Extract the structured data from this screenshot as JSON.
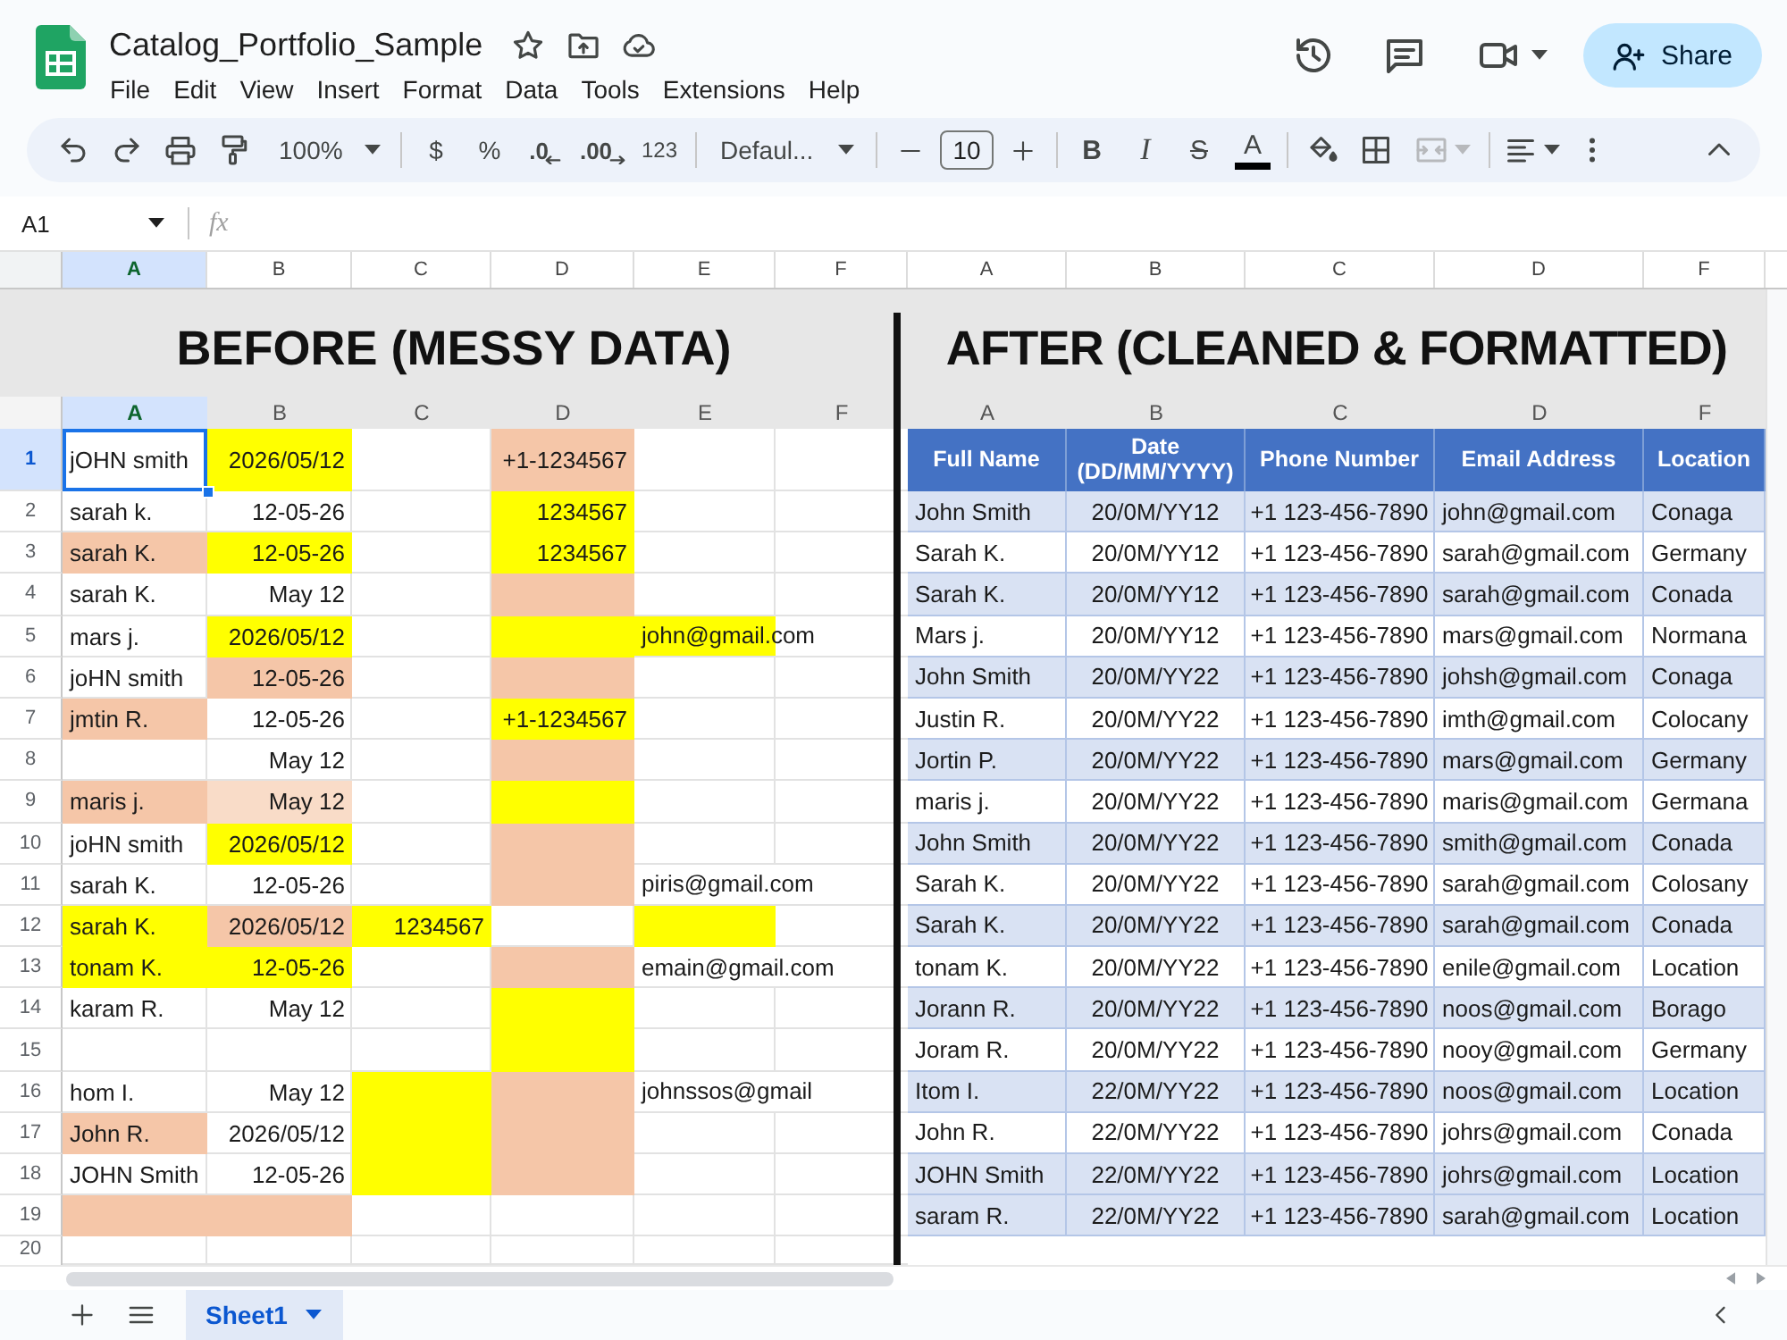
{
  "document": {
    "title": "Catalog_Portfolio_Sample"
  },
  "menu": [
    "File",
    "Edit",
    "View",
    "Insert",
    "Format",
    "Data",
    "Tools",
    "Extensions",
    "Help"
  ],
  "share_button": {
    "label": "Share"
  },
  "toolbar": {
    "zoom": "100%",
    "currency": "$",
    "percent": "%",
    "decrease_decimal": ".0",
    "increase_decimal": ".00",
    "number_format": "123",
    "font": "Defaul...",
    "font_size": "10",
    "bold": "B",
    "italic": "I",
    "strikethrough": "S",
    "text_color": "A",
    "merge_cells": {
      "disabled": true
    }
  },
  "formula_bar": {
    "name_box": "A1",
    "fx": "fx"
  },
  "column_headers": [
    {
      "label": "A",
      "selected": true
    },
    {
      "label": "B",
      "selected": false
    },
    {
      "label": "C",
      "selected": false
    },
    {
      "label": "D",
      "selected": false
    },
    {
      "label": "E",
      "selected": false
    },
    {
      "label": "F",
      "selected": false
    },
    {
      "label": "A",
      "selected": false
    },
    {
      "label": "B",
      "selected": false
    },
    {
      "label": "C",
      "selected": false
    },
    {
      "label": "D",
      "selected": false
    },
    {
      "label": "F",
      "selected": false
    }
  ],
  "before_sheet": {
    "title": "BEFORE (MESSY DATA)",
    "column_headers": [
      {
        "label": "A",
        "selected": true
      },
      {
        "label": "B",
        "selected": false
      },
      {
        "label": "C",
        "selected": false
      },
      {
        "label": "D",
        "selected": false
      },
      {
        "label": "E",
        "selected": false
      },
      {
        "label": "F",
        "selected": false
      }
    ],
    "rows": [
      {
        "number": "1",
        "selected": true,
        "cells": [
          {
            "text": "jOHN smith"
          },
          {
            "text": "2026/05/12",
            "color": "#ffff00"
          },
          {},
          {
            "text": "+1-1234567",
            "color": "#f5c6a8"
          }
        ]
      },
      {
        "number": "2",
        "selected": false,
        "cells": [
          {
            "text": "sarah k."
          },
          {
            "text": "12-05-26"
          },
          {},
          {
            "text": "1234567",
            "color": "#ffff00"
          }
        ]
      },
      {
        "number": "3",
        "selected": false,
        "cells": [
          {
            "text": "sarah K.",
            "color": "#f5c6a8"
          },
          {
            "text": "12-05-26",
            "color": "#ffff00"
          },
          {},
          {
            "text": "1234567",
            "color": "#ffff00"
          }
        ]
      },
      {
        "number": "4",
        "selected": false,
        "cells": [
          {
            "text": "sarah K."
          },
          {
            "text": "May 12"
          },
          {},
          {
            "color": "#f5c6a8"
          }
        ]
      },
      {
        "number": "5",
        "selected": false,
        "cells": [
          {
            "text": "mars j."
          },
          {
            "text": "2026/05/12",
            "color": "#ffff00"
          },
          {},
          {
            "color": "#ffff00"
          },
          {
            "text": "john@gmail.com",
            "color": "#ffff00"
          }
        ]
      },
      {
        "number": "6",
        "selected": false,
        "cells": [
          {
            "text": "joHN smith"
          },
          {
            "text": "12-05-26",
            "color": "#f5c6a8"
          },
          {},
          {
            "color": "#f5c6a8"
          }
        ]
      },
      {
        "number": "7",
        "selected": false,
        "cells": [
          {
            "text": "jmtin R.",
            "color": "#f5c6a8"
          },
          {
            "text": "12-05-26"
          },
          {},
          {
            "text": "+1-1234567",
            "color": "#ffff00"
          }
        ]
      },
      {
        "number": "8",
        "selected": false,
        "cells": [
          {},
          {
            "text": "May 12"
          },
          {},
          {
            "color": "#f5c6a8"
          }
        ]
      },
      {
        "number": "9",
        "selected": false,
        "cells": [
          {
            "text": "maris j.",
            "color": "#f5c6a8"
          },
          {
            "text": "May 12",
            "color": "#f9dcc8"
          },
          {},
          {
            "color": "#ffff00"
          }
        ]
      },
      {
        "number": "10",
        "selected": false,
        "cells": [
          {
            "text": "joHN smith"
          },
          {
            "text": "2026/05/12",
            "color": "#ffff00"
          },
          {},
          {
            "color": "#f5c6a8"
          }
        ]
      },
      {
        "number": "11",
        "selected": false,
        "cells": [
          {
            "text": "sarah K."
          },
          {
            "text": "12-05-26"
          },
          {},
          {
            "color": "#f5c6a8"
          },
          {
            "text": "piris@gmail.com"
          }
        ]
      },
      {
        "number": "12",
        "selected": false,
        "cells": [
          {
            "text": "sarah K.",
            "color": "#ffff00"
          },
          {
            "text": "2026/05/12",
            "color": "#f5c6a8"
          },
          {
            "text": "1234567",
            "color": "#ffff00"
          },
          {},
          {
            "color": "#ffff00"
          }
        ]
      },
      {
        "number": "13",
        "selected": false,
        "cells": [
          {
            "text": "tonam K.",
            "color": "#ffff00"
          },
          {
            "text": "12-05-26",
            "color": "#ffff00"
          },
          {},
          {
            "color": "#f5c6a8"
          },
          {
            "text": "emain@gmail.com"
          }
        ]
      },
      {
        "number": "14",
        "selected": false,
        "cells": [
          {
            "text": "karam R."
          },
          {
            "text": "May 12"
          },
          {},
          {
            "color": "#ffff00"
          }
        ]
      },
      {
        "number": "15",
        "selected": false,
        "cells": [
          {},
          {},
          {},
          {
            "color": "#ffff00"
          }
        ]
      },
      {
        "number": "16",
        "selected": false,
        "cells": [
          {
            "text": "hom I."
          },
          {
            "text": "May 12"
          },
          {
            "color": "#ffff00"
          },
          {
            "color": "#f5c6a8"
          },
          {
            "text": "johnssos@gmail"
          }
        ]
      },
      {
        "number": "17",
        "selected": false,
        "cells": [
          {
            "text": "John R.",
            "color": "#f5c6a8"
          },
          {
            "text": "2026/05/12"
          },
          {
            "color": "#ffff00"
          },
          {
            "color": "#f5c6a8"
          }
        ]
      },
      {
        "number": "18",
        "selected": false,
        "cells": [
          {
            "text": "JOHN Smith"
          },
          {
            "text": "12-05-26"
          },
          {
            "color": "#ffff00"
          },
          {
            "color": "#f5c6a8"
          }
        ]
      },
      {
        "number": "19",
        "selected": false,
        "cells": [
          {
            "color": "#f5c6a8"
          },
          {
            "color": "#f5c6a8"
          }
        ]
      },
      {
        "number": "20",
        "selected": false
      }
    ]
  },
  "after_sheet": {
    "title": "AFTER (CLEANED & FORMATTED)",
    "column_headers": [
      "A",
      "B",
      "C",
      "D",
      "F"
    ],
    "table": {
      "columns": [
        "Full Name",
        "Date (DD/MM/YYYY)",
        "Phone Number",
        "Email Address",
        "Location"
      ],
      "rows": [
        {
          "shaded": true,
          "cells": [
            "John Smith",
            "20/0M/YY12",
            "+1 123-456-7890",
            "john@gmail.com",
            "Conaga"
          ]
        },
        {
          "shaded": false,
          "cells": [
            "Sarah K.",
            "20/0M/YY12",
            "+1 123-456-7890",
            "sarah@gmail.com",
            "Germany"
          ]
        },
        {
          "shaded": true,
          "cells": [
            "Sarah K.",
            "20/0M/YY12",
            "+1 123-456-7890",
            "sarah@gmail.com",
            "Conada"
          ]
        },
        {
          "shaded": false,
          "cells": [
            "Mars j.",
            "20/0M/YY12",
            "+1 123-456-7890",
            "mars@gmail.com",
            "Normana"
          ]
        },
        {
          "shaded": true,
          "cells": [
            "John Smith",
            "20/0M/YY22",
            "+1 123-456-7890",
            "johsh@gmail.com",
            "Conaga"
          ]
        },
        {
          "shaded": false,
          "cells": [
            "Justin R.",
            "20/0M/YY22",
            "+1 123-456-7890",
            "imth@gmail.com",
            "Colocany"
          ]
        },
        {
          "shaded": true,
          "cells": [
            "Jortin P.",
            "20/0M/YY22",
            "+1 123-456-7890",
            "mars@gmail.com",
            "Germany"
          ]
        },
        {
          "shaded": false,
          "cells": [
            "maris j.",
            "20/0M/YY22",
            "+1 123-456-7890",
            "maris@gmail.com",
            "Germana"
          ]
        },
        {
          "shaded": true,
          "cells": [
            "John Smith",
            "20/0M/YY22",
            "+1 123-456-7890",
            "smith@gmail.com",
            "Conada"
          ]
        },
        {
          "shaded": false,
          "cells": [
            "Sarah K.",
            "20/0M/YY22",
            "+1 123-456-7890",
            "sarah@gmail.com",
            "Colosany"
          ]
        },
        {
          "shaded": true,
          "cells": [
            "Sarah K.",
            "20/0M/YY22",
            "+1 123-456-7890",
            "sarah@gmail.com",
            "Conada"
          ]
        },
        {
          "shaded": false,
          "cells": [
            "tonam K.",
            "20/0M/YY22",
            "+1 123-456-7890",
            "enile@gmail.com",
            "Location"
          ]
        },
        {
          "shaded": true,
          "cells": [
            "Jorann R.",
            "20/0M/YY22",
            "+1 123-456-7890",
            "noos@gmail.com",
            "Borago"
          ]
        },
        {
          "shaded": false,
          "cells": [
            "Joram R.",
            "20/0M/YY22",
            "+1 123-456-7890",
            "nooy@gmail.com",
            "Germany"
          ]
        },
        {
          "shaded": true,
          "cells": [
            "Itom I.",
            "22/0M/YY22",
            "+1 123-456-7890",
            "noos@gmail.com",
            "Location"
          ]
        },
        {
          "shaded": false,
          "cells": [
            "John R.",
            "22/0M/YY22",
            "+1 123-456-7890",
            "johrs@gmail.com",
            "Conada"
          ]
        },
        {
          "shaded": true,
          "cells": [
            "JOHN Smith",
            "22/0M/YY22",
            "+1 123-456-7890",
            "johrs@gmail.com",
            "Location"
          ]
        },
        {
          "shaded": true,
          "cells": [
            "saram R.",
            "22/0M/YY22",
            "+1 123-456-7890",
            "sarah@gmail.com",
            "Location"
          ]
        }
      ]
    }
  },
  "sheet_tabs": [
    {
      "label": "Sheet1",
      "selected": true
    }
  ]
}
